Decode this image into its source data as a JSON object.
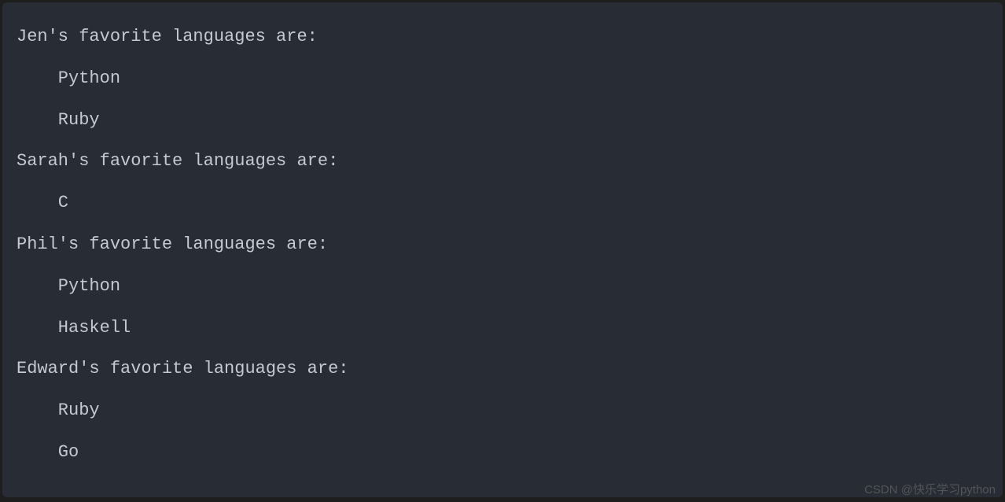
{
  "output": {
    "lines": [
      "Jen's favorite languages are:",
      "    Python",
      "    Ruby",
      "Sarah's favorite languages are:",
      "    C",
      "Phil's favorite languages are:",
      "    Python",
      "    Haskell",
      "Edward's favorite languages are:",
      "    Ruby",
      "    Go"
    ]
  },
  "watermark": "CSDN @快乐学习python"
}
